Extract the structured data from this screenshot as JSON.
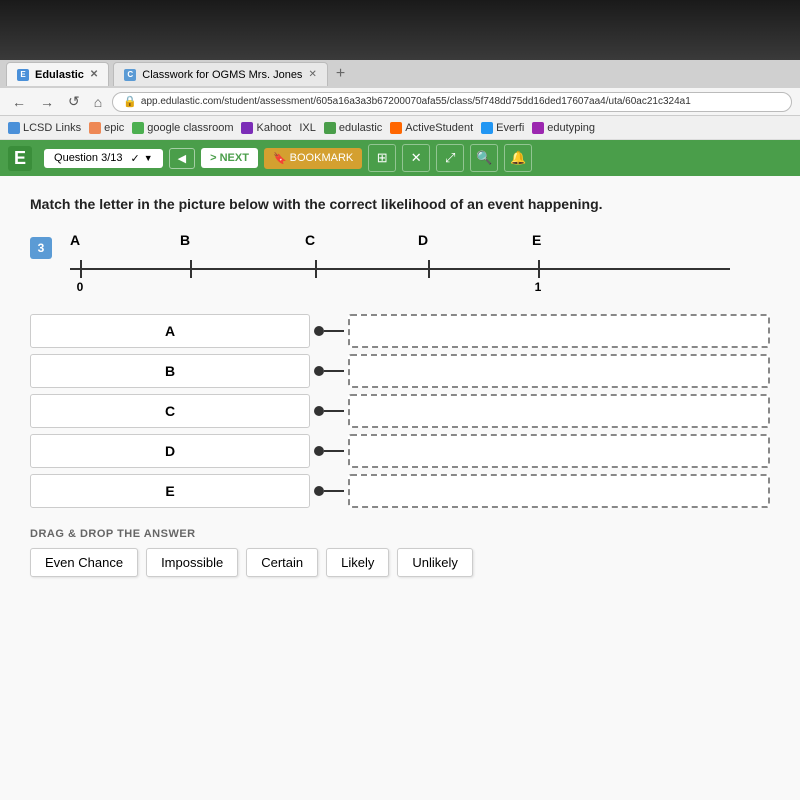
{
  "top_area": {
    "height": 60
  },
  "browser": {
    "tabs": [
      {
        "label": "Edulastic",
        "icon": "E",
        "active": true
      },
      {
        "label": "Classwork for OGMS Mrs. Jones",
        "icon": "C",
        "active": false
      }
    ],
    "address": "app.edulastic.com/student/assessment/605a16a3a3b67200070afa55/class/5f748dd75dd16ded17607aa4/uta/60ac21c324a1",
    "bookmarks": [
      {
        "label": "LCSD Links"
      },
      {
        "label": "epic"
      },
      {
        "label": "google classroom"
      },
      {
        "label": "Kahoot"
      },
      {
        "label": "IXL"
      },
      {
        "label": "edulastic"
      },
      {
        "label": "ActiveStudent"
      },
      {
        "label": "Everfi"
      },
      {
        "label": "edutyping"
      }
    ]
  },
  "toolbar": {
    "logo": "E",
    "question": "Question 3/13",
    "nav_prev": "<",
    "nav_next": "> NEXT",
    "bookmark": "BOOKMARK",
    "icons": [
      "grid",
      "x",
      "expand",
      "search",
      "bell"
    ]
  },
  "content": {
    "question_text": "Match the letter in the picture below with the correct likelihood of an event happening.",
    "question_number": "3",
    "number_line": {
      "labels": [
        "A",
        "B",
        "C",
        "D",
        "E"
      ],
      "label_positions": [
        10,
        120,
        250,
        370,
        480
      ],
      "tick_positions": [
        10,
        120,
        250,
        370,
        480
      ],
      "start_label": "0",
      "end_label": "1"
    },
    "match_items": [
      {
        "label": "A"
      },
      {
        "label": "B"
      },
      {
        "label": "C"
      },
      {
        "label": "D"
      },
      {
        "label": "E"
      }
    ],
    "drag_label": "DRAG & DROP THE ANSWER",
    "drag_items": [
      {
        "label": "Even Chance"
      },
      {
        "label": "Impossible"
      },
      {
        "label": "Certain"
      },
      {
        "label": "Likely"
      },
      {
        "label": "Unlikely"
      }
    ]
  }
}
